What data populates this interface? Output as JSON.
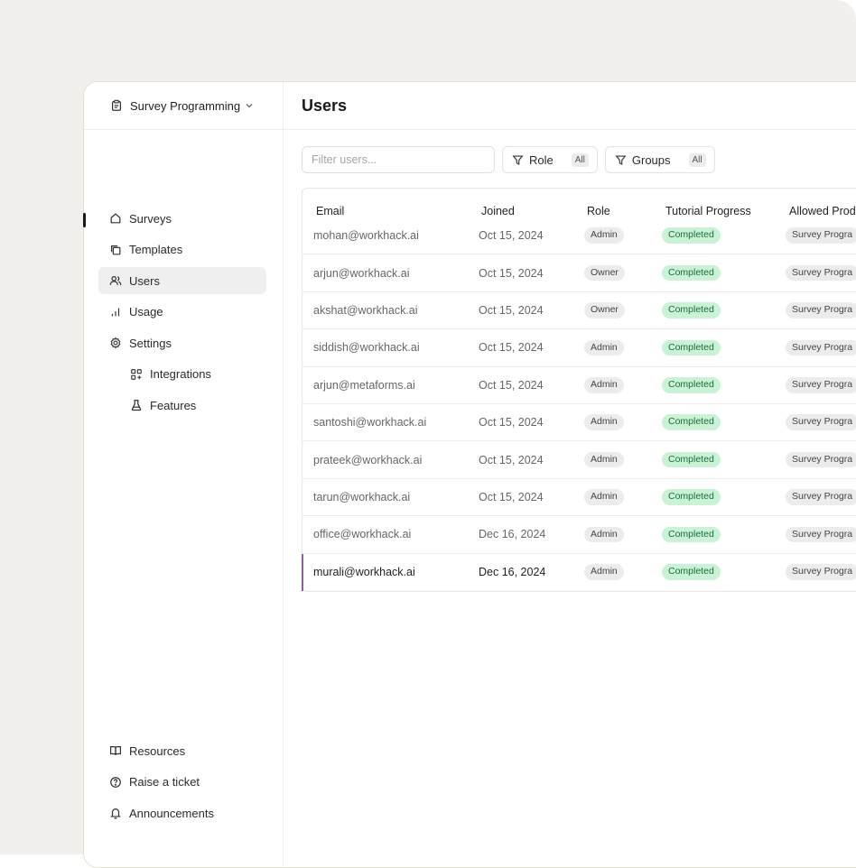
{
  "app": {
    "workspace_name": "Survey Programming",
    "page_title": "Users"
  },
  "sidebar": {
    "items": [
      {
        "label": "Surveys",
        "icon": "home-icon"
      },
      {
        "label": "Templates",
        "icon": "copy-icon"
      },
      {
        "label": "Users",
        "icon": "users-icon",
        "active": true
      },
      {
        "label": "Usage",
        "icon": "bar-chart-icon"
      },
      {
        "label": "Settings",
        "icon": "gear-icon"
      },
      {
        "label": "Integrations",
        "icon": "grid-icon"
      },
      {
        "label": "Features",
        "icon": "flask-icon"
      }
    ],
    "bottom": [
      {
        "label": "Resources",
        "icon": "book-icon"
      },
      {
        "label": "Raise a ticket",
        "icon": "help-circle-icon"
      },
      {
        "label": "Announcements",
        "icon": "bell-icon"
      }
    ]
  },
  "filters": {
    "search_placeholder": "Filter users...",
    "role_label": "Role",
    "role_value": "All",
    "groups_label": "Groups",
    "groups_value": "All"
  },
  "table": {
    "columns": [
      "Email",
      "Joined",
      "Role",
      "Tutorial Progress",
      "Allowed Prod"
    ],
    "rows": [
      {
        "email": "mohan@workhack.ai",
        "joined": "Oct 15, 2024",
        "role": "Admin",
        "progress": "Completed",
        "product": "Survey Progra"
      },
      {
        "email": "arjun@workhack.ai",
        "joined": "Oct 15, 2024",
        "role": "Owner",
        "progress": "Completed",
        "product": "Survey Progra"
      },
      {
        "email": "akshat@workhack.ai",
        "joined": "Oct 15, 2024",
        "role": "Owner",
        "progress": "Completed",
        "product": "Survey Progra"
      },
      {
        "email": "siddish@workhack.ai",
        "joined": "Oct 15, 2024",
        "role": "Admin",
        "progress": "Completed",
        "product": "Survey Progra"
      },
      {
        "email": "arjun@metaforms.ai",
        "joined": "Oct 15, 2024",
        "role": "Admin",
        "progress": "Completed",
        "product": "Survey Progra"
      },
      {
        "email": "santoshi@workhack.ai",
        "joined": "Oct 15, 2024",
        "role": "Admin",
        "progress": "Completed",
        "product": "Survey Progra"
      },
      {
        "email": "prateek@workhack.ai",
        "joined": "Oct 15, 2024",
        "role": "Admin",
        "progress": "Completed",
        "product": "Survey Progra"
      },
      {
        "email": "tarun@workhack.ai",
        "joined": "Oct 15, 2024",
        "role": "Admin",
        "progress": "Completed",
        "product": "Survey Progra"
      },
      {
        "email": "office@workhack.ai",
        "joined": "Dec 16, 2024",
        "role": "Admin",
        "progress": "Completed",
        "product": "Survey Progra"
      },
      {
        "email": "murali@workhack.ai",
        "joined": "Dec 16, 2024",
        "role": "Admin",
        "progress": "Completed",
        "product": "Survey Progra",
        "selected": true
      }
    ]
  },
  "colors": {
    "completed_bg": "#c9f2d6",
    "completed_text": "#1f6b3a",
    "selected_marker": "#8a5fa8"
  }
}
